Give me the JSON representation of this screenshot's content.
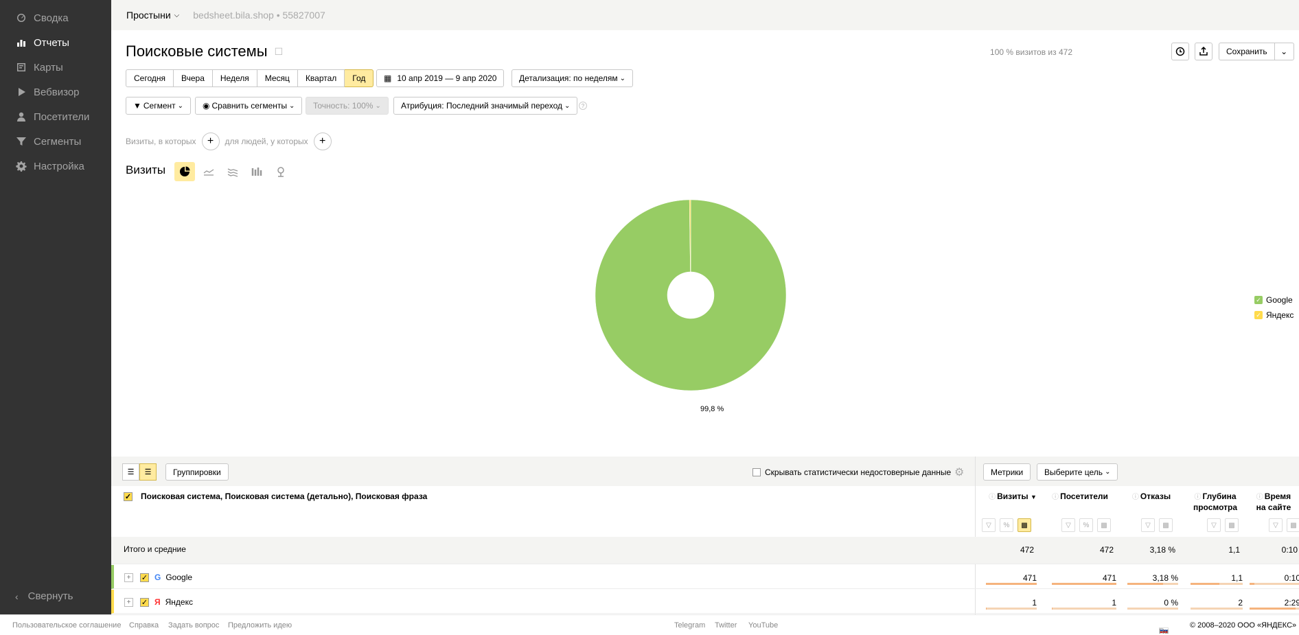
{
  "sidebar": {
    "items": [
      {
        "label": "Сводка",
        "icon": "gauge-icon"
      },
      {
        "label": "Отчеты",
        "icon": "bar-chart-icon"
      },
      {
        "label": "Карты",
        "icon": "map-icon"
      },
      {
        "label": "Вебвизор",
        "icon": "play-icon"
      },
      {
        "label": "Посетители",
        "icon": "user-icon"
      },
      {
        "label": "Сегменты",
        "icon": "funnel-icon"
      },
      {
        "label": "Настройка",
        "icon": "gear-icon"
      }
    ],
    "collapse_label": "Свернуть"
  },
  "topbar": {
    "counter": "Простыни",
    "site": "bedsheet.bila.shop • 55827007"
  },
  "header": {
    "title": "Поисковые системы",
    "visit_share": "100 % визитов из 472",
    "save_label": "Сохранить"
  },
  "period": {
    "options": [
      "Сегодня",
      "Вчера",
      "Неделя",
      "Месяц",
      "Квартал",
      "Год"
    ],
    "selected": "Год",
    "date_range": "10 апр 2019 — 9 апр 2020",
    "detail": "Детализация: по неделям"
  },
  "segments": {
    "segment": "Сегмент",
    "compare": "Сравнить сегменты",
    "accuracy": "Точность: 100%",
    "attribution": "Атрибуция: Последний значимый переход"
  },
  "filters": {
    "visits_where": "Визиты, в которых",
    "people_where": "для людей, у которых"
  },
  "chart": {
    "metric_label": "Визиты",
    "colors": {
      "google": "#97cc64",
      "yandex": "#ffdb4d"
    }
  },
  "chart_data": {
    "type": "pie",
    "labels": [
      "Google",
      "Яндекс"
    ],
    "values": [
      471,
      1
    ],
    "data_label": "99,8 %",
    "legend_position": "right"
  },
  "table": {
    "group_label": "Группировки",
    "hide_unreliable": "Скрывать статистически недостоверные данные",
    "metrics_label": "Метрики",
    "goal_label": "Выберите цель",
    "dimension_header": "Поисковая система, Поисковая система (детально), Поисковая фраза",
    "columns": [
      {
        "l1": "Визиты",
        "l2": ""
      },
      {
        "l1": "Посетители",
        "l2": ""
      },
      {
        "l1": "Отказы",
        "l2": ""
      },
      {
        "l1": "Глубина",
        "l2": "просмотра"
      },
      {
        "l1": "Время",
        "l2": "на сайте"
      }
    ],
    "total": {
      "label": "Итого и средние",
      "values": [
        "472",
        "472",
        "3,18 %",
        "1,1",
        "0:10"
      ]
    },
    "rows": [
      {
        "name": "Google",
        "logo": "G",
        "values": [
          "471",
          "471",
          "3,18 %",
          "1,1",
          "0:10"
        ],
        "bars": [
          0.998,
          0.998,
          0.7,
          0.55,
          0.1
        ]
      },
      {
        "name": "Яндекс",
        "logo": "Я",
        "values": [
          "1",
          "1",
          "0 %",
          "2",
          "2:29"
        ],
        "bars": [
          0.002,
          0.002,
          0,
          0,
          0.9
        ]
      }
    ]
  },
  "footer": {
    "left": [
      "Пользовательское соглашение",
      "Справка",
      "Задать вопрос",
      "Предложить идею"
    ],
    "center": [
      "Telegram",
      "Twitter",
      "YouTube"
    ],
    "lang": "Ru",
    "copyright": "© 2008–2020  ООО «ЯНДЕКС»"
  }
}
